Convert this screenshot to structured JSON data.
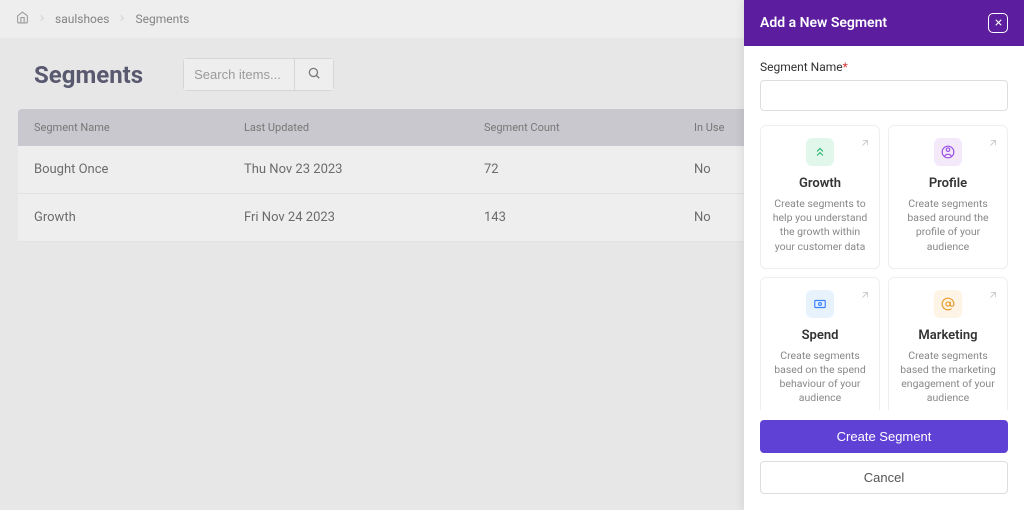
{
  "breadcrumb": {
    "home_icon": "home",
    "items": [
      "saulshoes",
      "Segments"
    ]
  },
  "page": {
    "title": "Segments",
    "search_placeholder": "Search items..."
  },
  "table": {
    "columns": [
      "Segment Name",
      "Last Updated",
      "Segment Count",
      "In Use"
    ],
    "rows": [
      {
        "name": "Bought Once",
        "updated": "Thu Nov 23 2023",
        "count": "72",
        "in_use": "No"
      },
      {
        "name": "Growth",
        "updated": "Fri Nov 24 2023",
        "count": "143",
        "in_use": "No"
      }
    ]
  },
  "drawer": {
    "title": "Add a New Segment",
    "name_label": "Segment Name",
    "name_value": "",
    "cards": [
      {
        "key": "growth",
        "title": "Growth",
        "desc": "Create segments to help you understand the growth within your customer data"
      },
      {
        "key": "profile",
        "title": "Profile",
        "desc": "Create segments based around the profile of your audience"
      },
      {
        "key": "spend",
        "title": "Spend",
        "desc": "Create segments based on the spend behaviour of your audience"
      },
      {
        "key": "marketing",
        "title": "Marketing",
        "desc": "Create segments based the marketing engagement of your audience"
      }
    ],
    "create_btn": "Create Segment",
    "cancel_btn": "Cancel"
  }
}
